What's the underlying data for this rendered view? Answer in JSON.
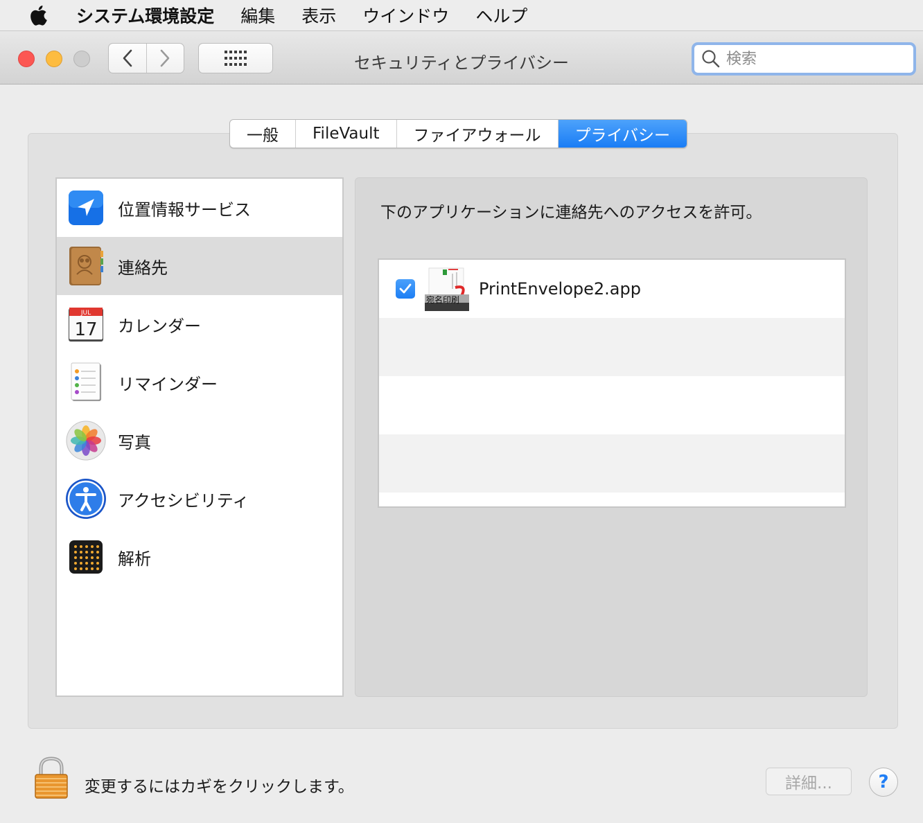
{
  "menubar": {
    "apple_icon": "apple-logo-icon",
    "app_name": "システム環境設定",
    "items": [
      "編集",
      "表示",
      "ウインドウ",
      "ヘルプ"
    ]
  },
  "window": {
    "title": "セキュリティとプライバシー",
    "traffic_lights": {
      "close": "#fc5753",
      "minimize": "#fdbc40",
      "zoom": "#cdcdcd"
    },
    "search": {
      "placeholder": "検索",
      "value": ""
    }
  },
  "tabs": [
    {
      "label": "一般",
      "active": false
    },
    {
      "label": "FileVault",
      "active": false
    },
    {
      "label": "ファイアウォール",
      "active": false
    },
    {
      "label": "プライバシー",
      "active": true
    }
  ],
  "sidebar": {
    "items": [
      {
        "label": "位置情報サービス",
        "icon": "location-arrow-icon",
        "selected": false
      },
      {
        "label": "連絡先",
        "icon": "contacts-book-icon",
        "selected": true
      },
      {
        "label": "カレンダー",
        "icon": "calendar-icon",
        "selected": false
      },
      {
        "label": "リマインダー",
        "icon": "reminders-icon",
        "selected": false
      },
      {
        "label": "写真",
        "icon": "photos-flower-icon",
        "selected": false
      },
      {
        "label": "アクセシビリティ",
        "icon": "accessibility-icon",
        "selected": false
      },
      {
        "label": "解析",
        "icon": "analytics-grid-icon",
        "selected": false
      }
    ]
  },
  "calendar_icon": {
    "month": "JUL",
    "day": "17"
  },
  "content": {
    "description": "下のアプリケーションに連絡先へのアクセスを許可。",
    "apps": [
      {
        "name": "PrintEnvelope2.app",
        "checked": true,
        "icon": "print-envelope-app-icon",
        "icon_text": "宛名印刷"
      }
    ]
  },
  "bottom": {
    "lock_text": "変更するにはカギをクリックします。",
    "details_label": "詳細...",
    "help_label": "?"
  },
  "colors": {
    "accent": "#1a7df5",
    "checkbox": "#2a86f6"
  }
}
